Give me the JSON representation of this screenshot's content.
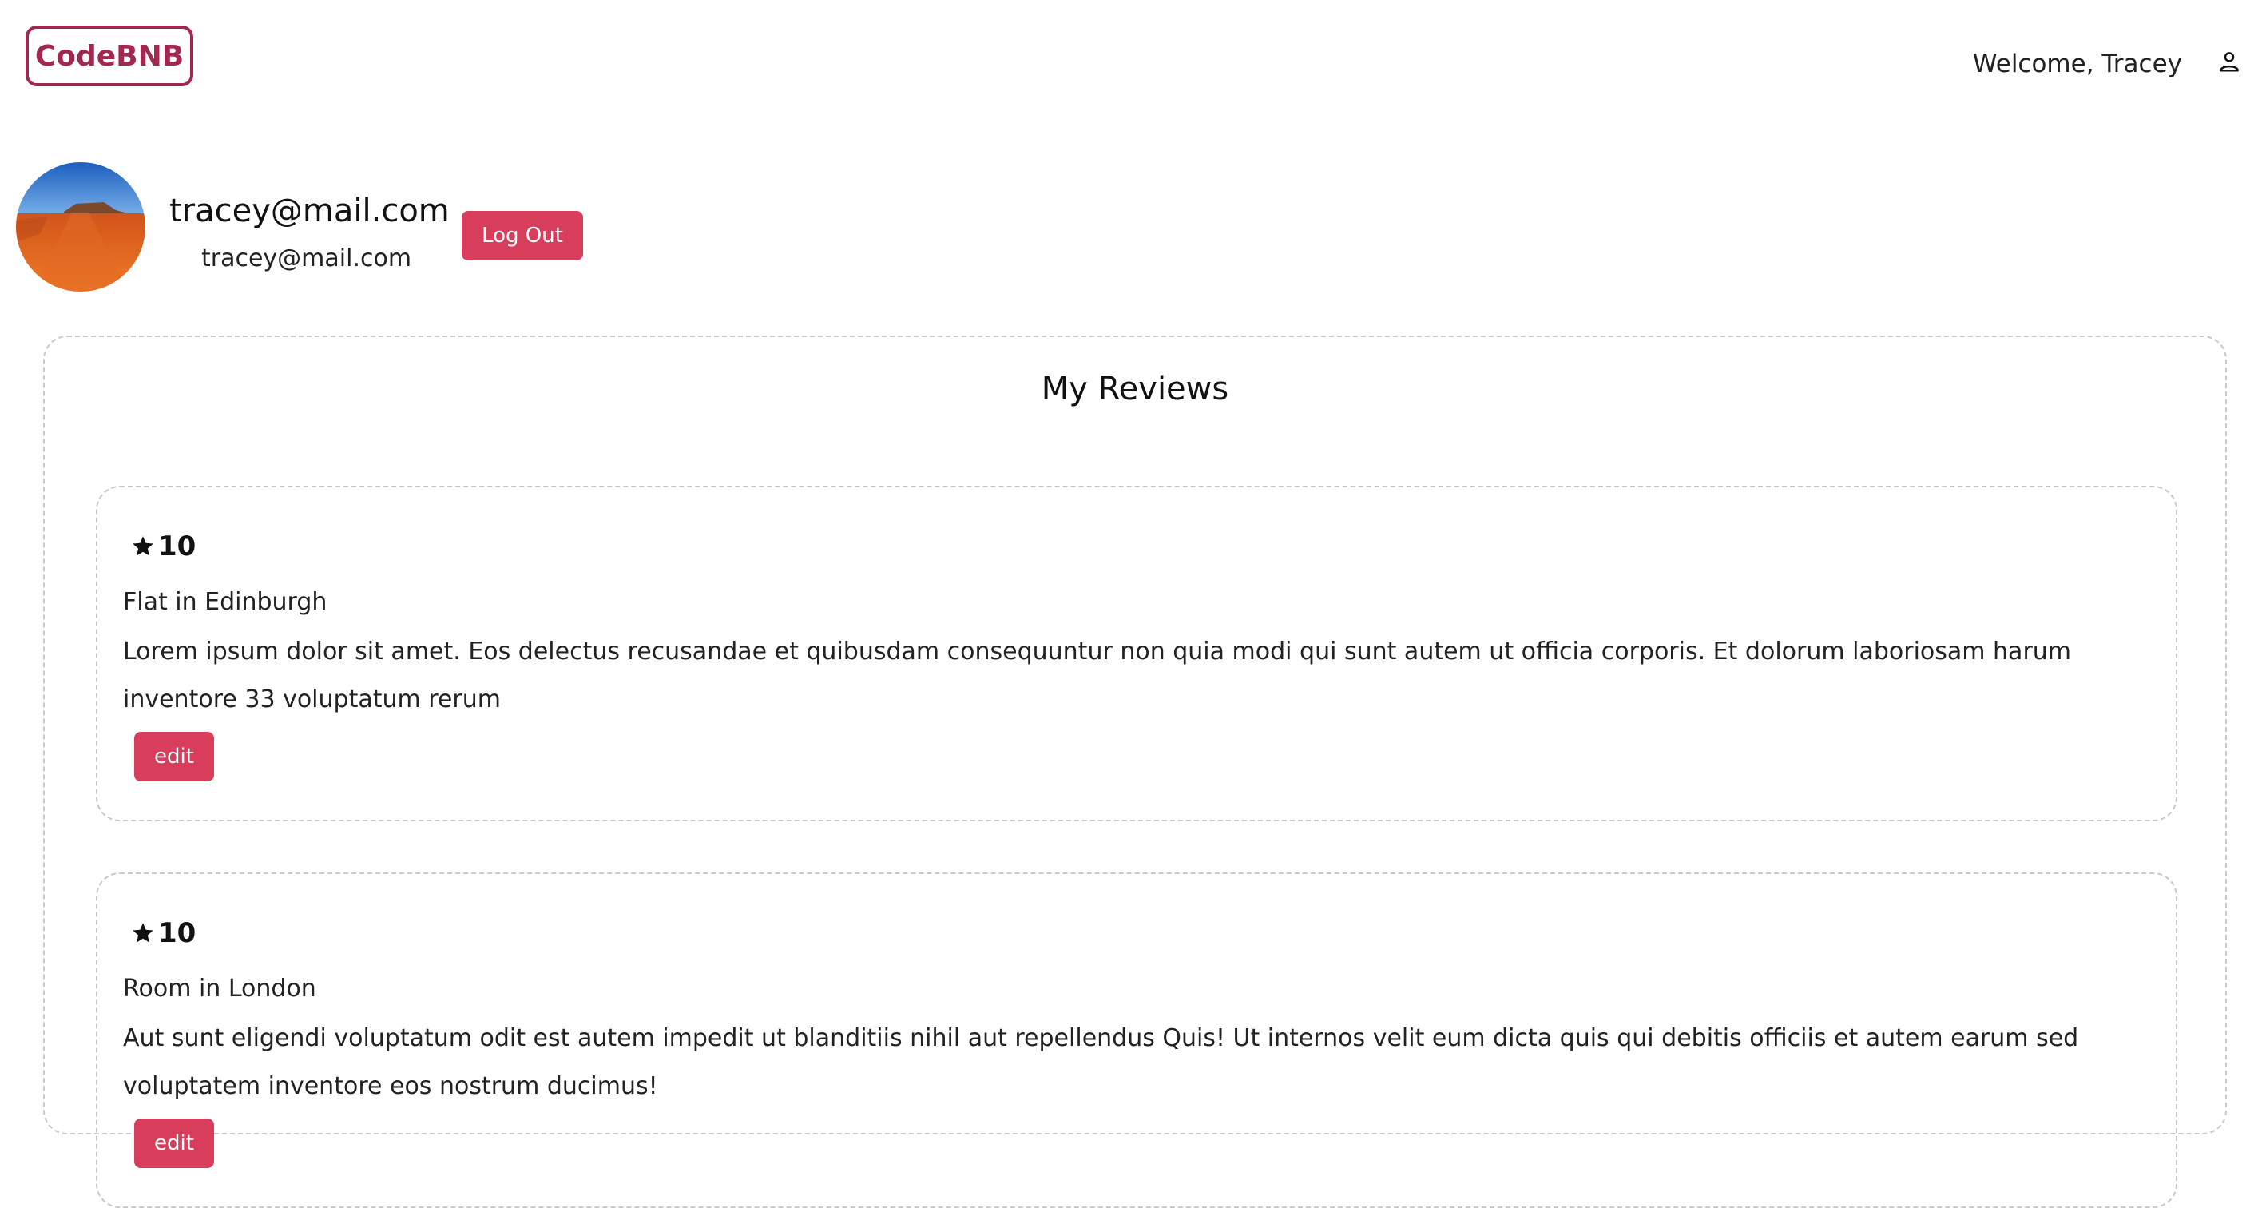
{
  "header": {
    "logo_text": "CodeBNB",
    "welcome_text": "Welcome, Tracey",
    "user_icon": "user-icon"
  },
  "profile": {
    "name": "tracey@mail.com",
    "email": "tracey@mail.com",
    "logout_label": "Log Out",
    "avatar_alt": "profile-avatar"
  },
  "reviews": {
    "title": "My Reviews",
    "items": [
      {
        "rating": "10",
        "listing": "Flat in Edinburgh",
        "text": "Lorem ipsum dolor sit amet. Eos delectus recusandae et quibusdam consequuntur non quia modi qui sunt autem ut officia corporis. Et dolorum laboriosam harum inventore 33 voluptatum rerum",
        "edit_label": "edit"
      },
      {
        "rating": "10",
        "listing": "Room in London",
        "text": "Aut sunt eligendi voluptatum odit est autem impedit ut blanditiis nihil aut repellendus Quis! Ut internos velit eum dicta quis qui debitis officiis et autem earum sed voluptatem inventore eos nostrum ducimus!",
        "edit_label": "edit"
      }
    ]
  },
  "colors": {
    "brand": "#a3284f",
    "button": "#d83e5c",
    "border": "#c9c9c9"
  }
}
